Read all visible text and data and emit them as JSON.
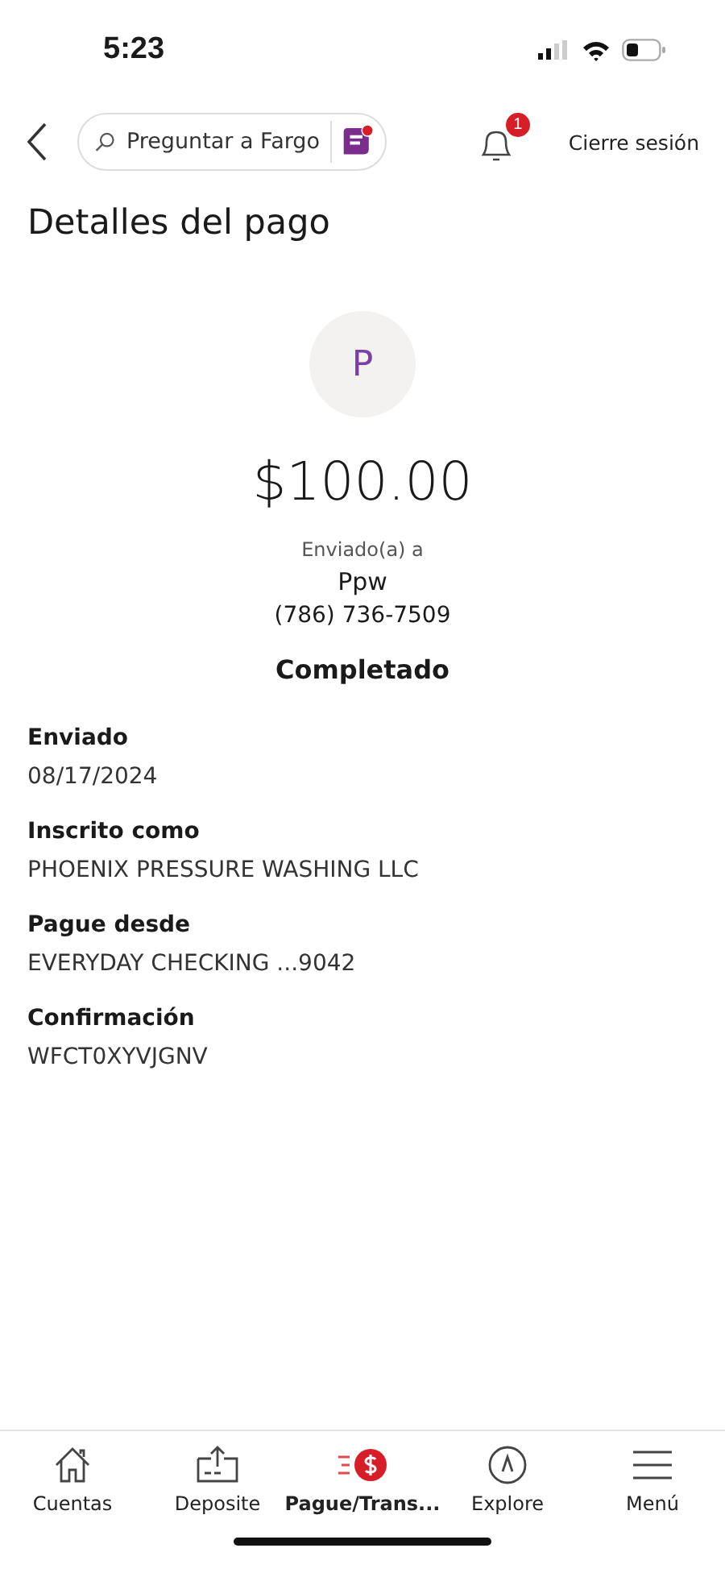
{
  "status_bar": {
    "time": "5:23"
  },
  "header": {
    "search": {
      "placeholder": "Preguntar a Fargo"
    },
    "notifications": {
      "badge": "1"
    },
    "logout": "Cierre sesión"
  },
  "title": "Detalles del pago",
  "payment": {
    "avatar": "P",
    "amount": "$100.00",
    "sent_to_label": "Enviado(a) a",
    "recipient": "Ppw",
    "phone": "(786) 736-7509",
    "status": "Completado"
  },
  "details": [
    {
      "label": "Enviado",
      "value": "08/17/2024"
    },
    {
      "label": "Inscrito como",
      "value": "PHOENIX PRESSURE WASHING LLC"
    },
    {
      "label": "Pague desde",
      "value": "EVERYDAY CHECKING ...9042"
    },
    {
      "label": "Confirmación",
      "value": "WFCT0XYVJGNV"
    }
  ],
  "tab_bar": [
    {
      "kind": "home",
      "label": "Cuentas",
      "selected": false
    },
    {
      "kind": "deposit",
      "label": "Deposite",
      "selected": false
    },
    {
      "kind": "pay",
      "label": "Pague/Trans...",
      "selected": true
    },
    {
      "kind": "explore",
      "label": "Explore",
      "selected": false
    },
    {
      "kind": "menu",
      "label": "Menú",
      "selected": false
    }
  ]
}
